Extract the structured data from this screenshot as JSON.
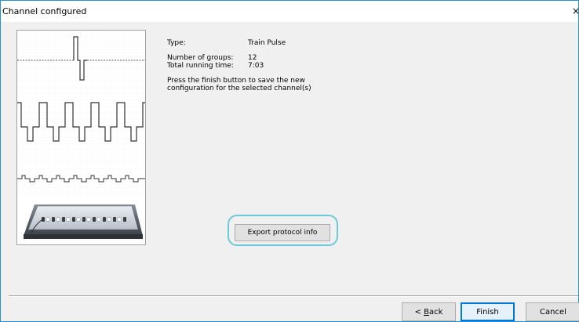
{
  "window": {
    "title": "Channel configured",
    "close_glyph": "×"
  },
  "info": {
    "type_label": "Type:",
    "type_value": "Train Pulse",
    "groups_label": "Number of groups:",
    "groups_value": "12",
    "time_label": "Total running time:",
    "time_value": "7:03",
    "message_line1": "Press the finish button to save the new",
    "message_line2": "configuration for the selected channel(s)"
  },
  "buttons": {
    "export": "Export protocol info",
    "back_prefix": "< ",
    "back_key": "B",
    "back_rest": "ack",
    "finish": "Finish",
    "cancel": "Cancel"
  },
  "icons": {
    "close": "close-icon",
    "preview": "waveform-preview-illustration",
    "device": "stimulator-device-icon"
  },
  "colors": {
    "window_border": "#2b91d1",
    "highlight_ring": "#6cc9d9",
    "default_button_border": "#0078d7"
  }
}
